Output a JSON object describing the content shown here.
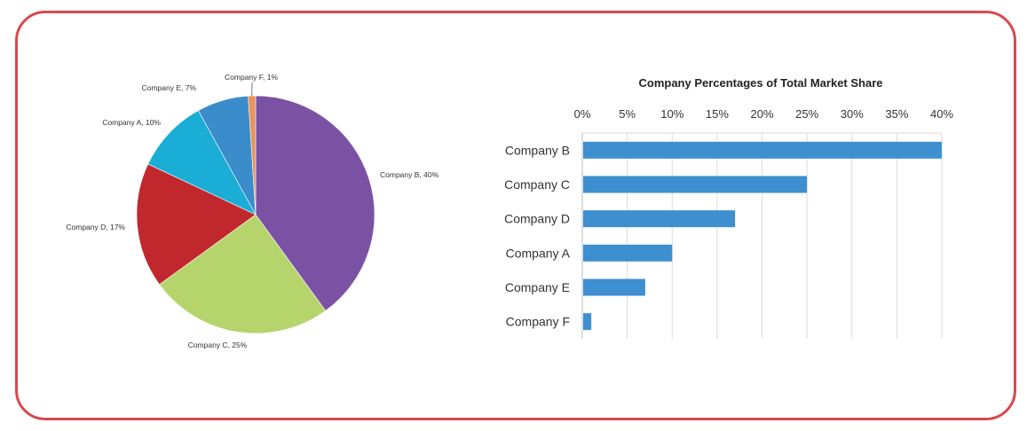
{
  "chart_data": [
    {
      "type": "pie",
      "slices": [
        {
          "label": "Company B, 40%",
          "name": "Company B",
          "value": 40,
          "color": "#7b52a3"
        },
        {
          "label": "Company C, 25%",
          "name": "Company C",
          "value": 25,
          "color": "#b5d56c"
        },
        {
          "label": "Company D, 17%",
          "name": "Company D",
          "value": 17,
          "color": "#c0282e"
        },
        {
          "label": "Company A, 10%",
          "name": "Company A",
          "value": 10,
          "color": "#1aaed6"
        },
        {
          "label": "Company E, 7%",
          "name": "Company E",
          "value": 7,
          "color": "#3b8ccb"
        },
        {
          "label": "Company F, 1%",
          "name": "Company F",
          "value": 1,
          "color": "#e8945a"
        }
      ],
      "start": "12 o'clock",
      "direction": "clockwise"
    },
    {
      "type": "bar",
      "orientation": "horizontal",
      "title": "Company Percentages of Total Market Share",
      "categories": [
        "Company B",
        "Company C",
        "Company D",
        "Company A",
        "Company E",
        "Company F"
      ],
      "values": [
        40,
        25,
        17,
        10,
        7,
        1
      ],
      "xticks": [
        "0%",
        "5%",
        "10%",
        "15%",
        "20%",
        "25%",
        "30%",
        "35%",
        "40%"
      ],
      "xlim": [
        0,
        40
      ],
      "bar_color": "#3e8fcf",
      "grid": true,
      "axis_position": "top"
    }
  ],
  "colors": {
    "frame_border": "#d9494d",
    "gridline": "#dcdcdc"
  }
}
